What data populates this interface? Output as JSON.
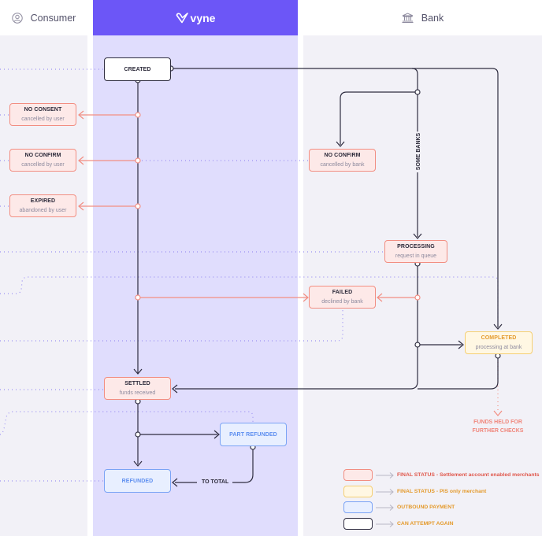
{
  "lanes": {
    "consumer": {
      "label": "Consumer",
      "icon": "user-circle-icon"
    },
    "vyne": {
      "label": "vyne",
      "icon": "vyne-logo-icon"
    },
    "bank": {
      "label": "Bank",
      "icon": "bank-building-icon"
    }
  },
  "nodes": {
    "created": {
      "title": "CREATED",
      "subtitle": ""
    },
    "no_consent": {
      "title": "NO CONSENT",
      "subtitle": "cancelled by user"
    },
    "no_confirm_user": {
      "title": "NO CONFIRM",
      "subtitle": "cancelled by user"
    },
    "expired": {
      "title": "EXPIRED",
      "subtitle": "abandoned by user"
    },
    "no_confirm_bank": {
      "title": "NO CONFIRM",
      "subtitle": "cancelled by bank"
    },
    "processing": {
      "title": "PROCESSING",
      "subtitle": "request in queue"
    },
    "failed": {
      "title": "FAILED",
      "subtitle": "declined by bank"
    },
    "completed": {
      "title": "COMPLETED",
      "subtitle": "processing at bank"
    },
    "settled": {
      "title": "SETTLED",
      "subtitle": "funds received"
    },
    "part_refunded": {
      "title": "PART REFUNDED",
      "subtitle": ""
    },
    "refunded": {
      "title": "REFUNDED",
      "subtitle": ""
    }
  },
  "edge_labels": {
    "some_banks": "SOME BANKS",
    "to_total": "TO TOTAL"
  },
  "notes": {
    "funds_held": "FUNDS HELD FOR FURTHER CHECKS"
  },
  "legend": [
    {
      "text": "FINAL STATUS - Settlement account enabled merchants",
      "fill": "#fde9e8",
      "border": "#f28e82",
      "text_color": "#e0584c"
    },
    {
      "text": "FINAL STATUS - PIS only merchant",
      "fill": "#fff7e3",
      "border": "#f5cf72",
      "text_color": "#e49a2c"
    },
    {
      "text": "OUTBOUND PAYMENT",
      "fill": "#e8efff",
      "border": "#7aa3f5",
      "text_color": "#e49a2c"
    },
    {
      "text": "CAN ATTEMPT AGAIN",
      "fill": "#ffffff",
      "border": "#2f2d40",
      "text_color": "#e49a2c"
    }
  ],
  "colors": {
    "brand": "#6c56f7",
    "vyne_lane": "#e0ddfd",
    "side_lane": "#f2f1f7",
    "flow_line": "#2f2d40",
    "fail_line": "#f28e82",
    "dotted_line": "#9c92f3"
  }
}
